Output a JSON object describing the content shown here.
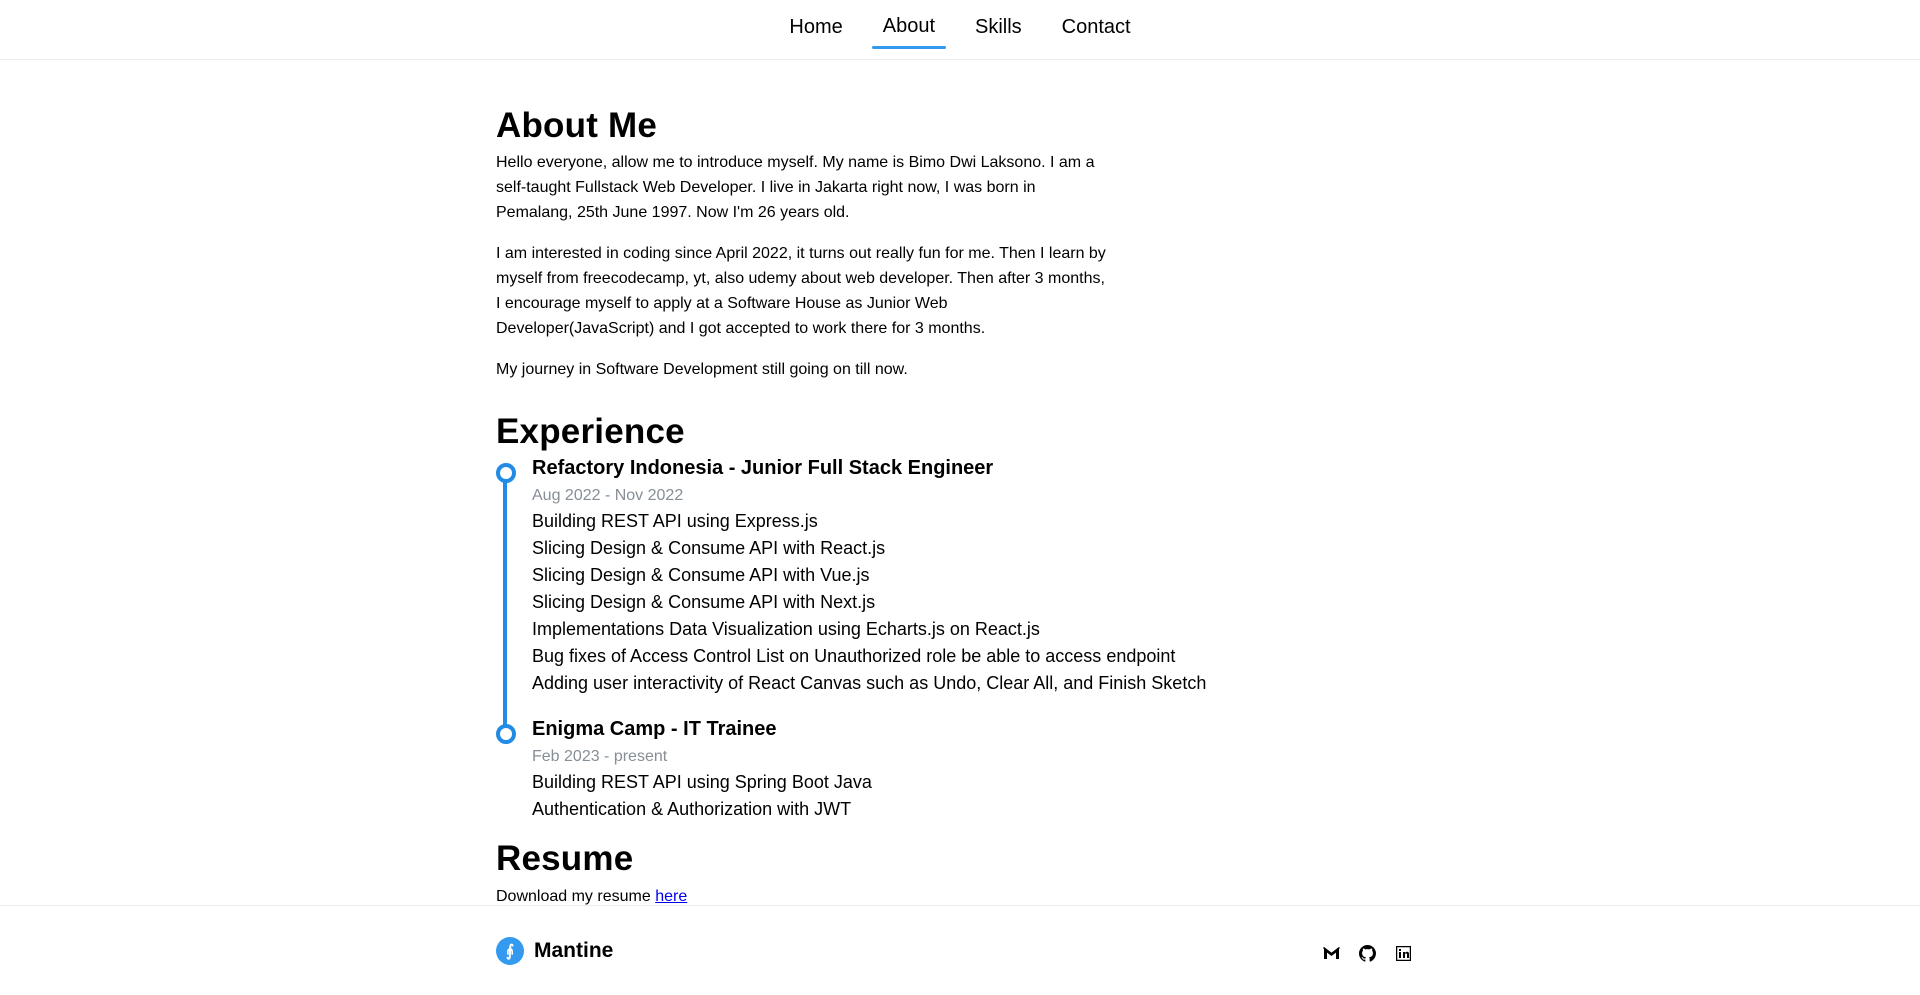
{
  "nav": {
    "items": [
      {
        "label": "Home"
      },
      {
        "label": "About"
      },
      {
        "label": "Skills"
      },
      {
        "label": "Contact"
      }
    ],
    "active": "About"
  },
  "about": {
    "title": "About Me",
    "paragraphs": [
      "Hello everyone, allow me to introduce myself. My name is Bimo Dwi Laksono. I am a self-taught Fullstack Web Developer. I live in Jakarta right now, I was born in Pemalang, 25th June 1997. Now I'm 26 years old.",
      "I am interested in coding since April 2022, it turns out really fun for me. Then I learn by myself from freecodecamp, yt, also udemy about web developer. Then after 3 months, I encourage myself to apply at a Software House as Junior Web Developer(JavaScript) and I got accepted to work there for 3 months.",
      "My journey in Software Development still going on till now."
    ]
  },
  "experience": {
    "title": "Experience",
    "items": [
      {
        "title": "Refactory Indonesia - Junior Full Stack Engineer",
        "date": "Aug 2022 - Nov 2022",
        "points": [
          "Building REST API using Express.js",
          "Slicing Design & Consume API with React.js",
          "Slicing Design & Consume API with Vue.js",
          "Slicing Design & Consume API with Next.js",
          "Implementations Data Visualization using Echarts.js on React.js",
          "Bug fixes of Access Control List on Unauthorized role be able to access endpoint",
          "Adding user interactivity of React Canvas such as Undo, Clear All, and Finish Sketch"
        ]
      },
      {
        "title": "Enigma Camp - IT Trainee",
        "date": "Feb 2023 - present",
        "points": [
          "Building REST API using Spring Boot Java",
          "Authentication & Authorization with JWT"
        ]
      }
    ]
  },
  "resume": {
    "title": "Resume",
    "text": "Download my resume",
    "link": "here"
  },
  "footer": {
    "logo_text": "Mantine",
    "logo_mark": "⨙",
    "socials": [
      "gmail-icon",
      "github-icon",
      "linkedin-icon"
    ]
  },
  "colors": {
    "accent": "#339af0",
    "timeline": "#228be6",
    "muted": "#868e96",
    "link": "#0000ee"
  }
}
